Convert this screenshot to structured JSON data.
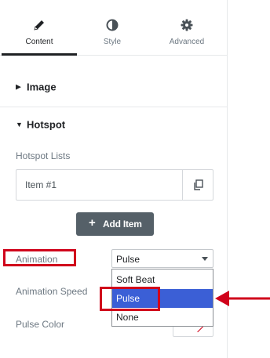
{
  "tabs": [
    {
      "label": "Content",
      "icon": "pencil-icon",
      "active": true
    },
    {
      "label": "Style",
      "icon": "half-circle-icon",
      "active": false
    },
    {
      "label": "Advanced",
      "icon": "gear-icon",
      "active": false
    }
  ],
  "sections": {
    "image": {
      "title": "Image",
      "expanded": false
    },
    "hotspot": {
      "title": "Hotspot",
      "expanded": true
    }
  },
  "hotspot": {
    "lists_label": "Hotspot Lists",
    "items": [
      {
        "title": "Item #1"
      }
    ],
    "add_item_label": "Add Item",
    "add_item_icon": "+",
    "animation_label": "Animation",
    "animation_value": "Pulse",
    "animation_options": [
      "Soft Beat",
      "Pulse",
      "None"
    ],
    "animation_speed_label": "Animation Speed",
    "pulse_color_label": "Pulse Color"
  },
  "colors": {
    "highlight": "#d0021b",
    "selected_option": "#3b5fd6",
    "add_button": "#556068"
  }
}
